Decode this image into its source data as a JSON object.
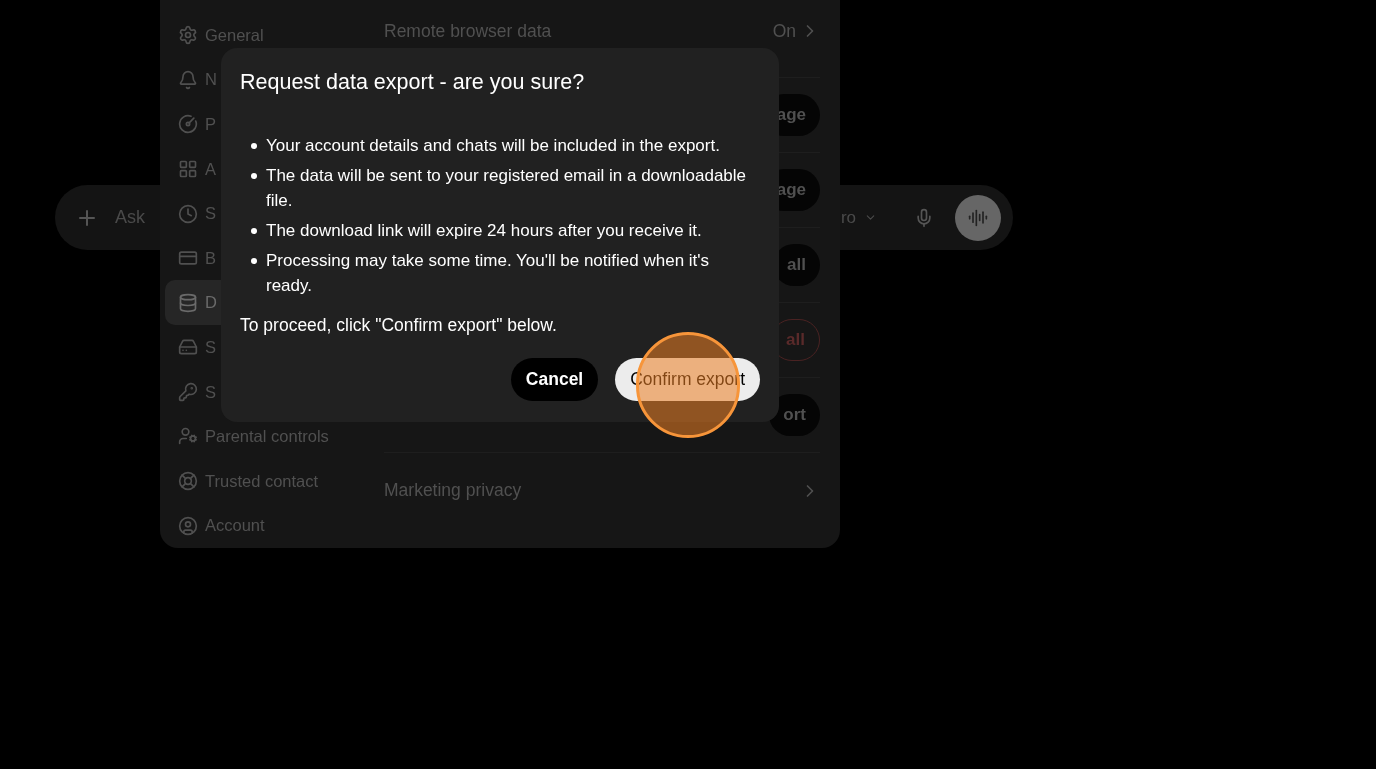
{
  "chat_bar": {
    "placeholder": "Ask",
    "model": "ro"
  },
  "settings": {
    "sidebar": [
      {
        "label": "General",
        "selected": false
      },
      {
        "label": "N",
        "selected": false
      },
      {
        "label": "P",
        "selected": false
      },
      {
        "label": "A",
        "selected": false
      },
      {
        "label": "S",
        "selected": false
      },
      {
        "label": "B",
        "selected": false
      },
      {
        "label": "D",
        "selected": true
      },
      {
        "label": "S",
        "selected": false
      },
      {
        "label": "S",
        "selected": false
      },
      {
        "label": "Parental controls",
        "selected": false
      },
      {
        "label": "Trusted contact",
        "selected": false
      },
      {
        "label": "Account",
        "selected": false
      }
    ],
    "rows": [
      {
        "kind": "link",
        "label": "Remote browser data",
        "value": "On"
      },
      {
        "kind": "button",
        "button": "age",
        "danger": false
      },
      {
        "kind": "button",
        "button": "age",
        "danger": false
      },
      {
        "kind": "button",
        "button": "all",
        "danger": false
      },
      {
        "kind": "button",
        "button": "all",
        "danger": true
      },
      {
        "kind": "button",
        "button": "ort",
        "danger": false
      },
      {
        "kind": "link",
        "label": "Marketing privacy"
      }
    ]
  },
  "dialog": {
    "title": "Request data export - are you sure?",
    "bullets": [
      "Your account details and chats will be included in the export.",
      "The data will be sent to your registered email in a downloadable file.",
      "The download link will expire 24 hours after you receive it.",
      "Processing may take some time. You'll be notified when it's ready."
    ],
    "note": "To proceed, click \"Confirm export\" below.",
    "buttons": [
      {
        "label": "Cancel",
        "kind": "secondary"
      },
      {
        "label": "Confirm export",
        "kind": "primary"
      }
    ]
  }
}
